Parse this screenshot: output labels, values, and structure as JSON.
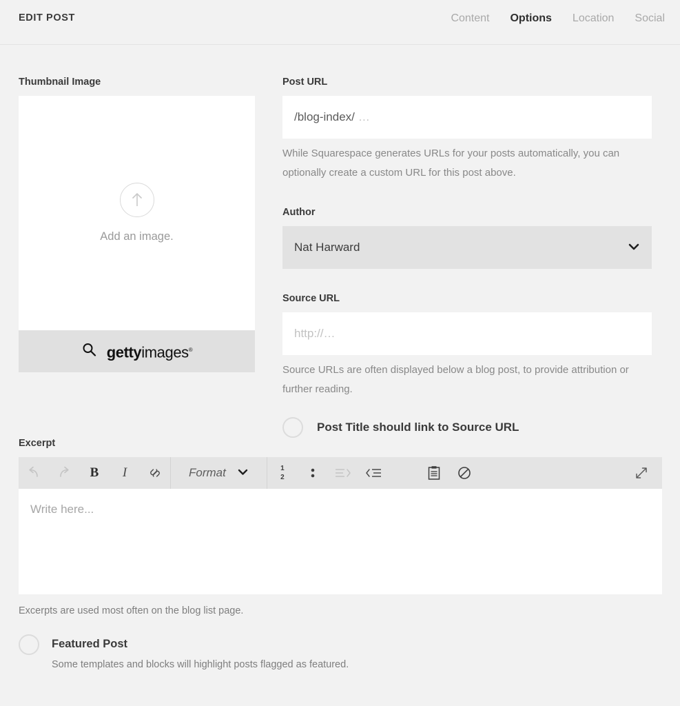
{
  "header": {
    "title": "EDIT POST",
    "tabs": [
      {
        "label": "Content",
        "active": false
      },
      {
        "label": "Options",
        "active": true
      },
      {
        "label": "Location",
        "active": false
      },
      {
        "label": "Social",
        "active": false
      }
    ]
  },
  "thumbnail": {
    "label": "Thumbnail Image",
    "placeholder_text": "Add an image.",
    "upload_icon": "arrow-up-circle-icon",
    "getty": {
      "search_icon": "search-icon",
      "brand_bold": "getty",
      "brand_light": "images",
      "trademark": "®"
    }
  },
  "post_url": {
    "label": "Post URL",
    "value": "/blog-index/",
    "value_suffix": "…",
    "help": "While Squarespace generates URLs for your posts automatically, you can optionally create a custom URL for this post above."
  },
  "author": {
    "label": "Author",
    "value": "Nat Harward",
    "chevron_icon": "chevron-down-icon"
  },
  "source_url": {
    "label": "Source URL",
    "placeholder": "http://…",
    "value": "",
    "help": "Source URLs are often displayed below a blog post, to provide attribution or further reading.",
    "toggle_label": "Post Title should link to Source URL",
    "toggle_on": false
  },
  "excerpt": {
    "label": "Excerpt",
    "placeholder": "Write here...",
    "help": "Excerpts are used most often on the blog list page.",
    "toolbar": {
      "undo": {
        "name": "undo-icon",
        "disabled": true
      },
      "redo": {
        "name": "redo-icon",
        "disabled": true
      },
      "bold": {
        "label": "B",
        "name": "bold-icon",
        "disabled": false
      },
      "italic": {
        "label": "I",
        "name": "italic-icon",
        "disabled": false
      },
      "link": {
        "name": "link-icon",
        "disabled": false
      },
      "format": {
        "label": "Format",
        "name": "format-dropdown",
        "chevron": "chevron-down-icon"
      },
      "numbered_list": {
        "top": "1",
        "bottom": "2",
        "name": "numbered-list-icon",
        "disabled": false
      },
      "bulleted_list": {
        "name": "bulleted-list-icon",
        "disabled": false
      },
      "indent": {
        "name": "indent-icon",
        "disabled": true
      },
      "outdent": {
        "name": "outdent-icon",
        "disabled": false
      },
      "paste": {
        "name": "clipboard-paste-icon",
        "disabled": false
      },
      "clear_formatting": {
        "name": "no-formatting-icon",
        "disabled": false
      },
      "expand": {
        "name": "expand-icon",
        "disabled": false
      }
    }
  },
  "featured": {
    "toggle_on": false,
    "title": "Featured Post",
    "subtitle": "Some templates and blocks will highlight posts flagged as featured."
  },
  "colors": {
    "page_background": "#f2f2f2",
    "input_background": "#ffffff",
    "select_background": "#e2e2e2",
    "toolbar_background": "#e4e4e4",
    "getty_bar_background": "#e0e0e0",
    "text_primary": "#3a3a3a",
    "text_muted": "#888888",
    "tab_inactive": "#a9a9a9"
  }
}
